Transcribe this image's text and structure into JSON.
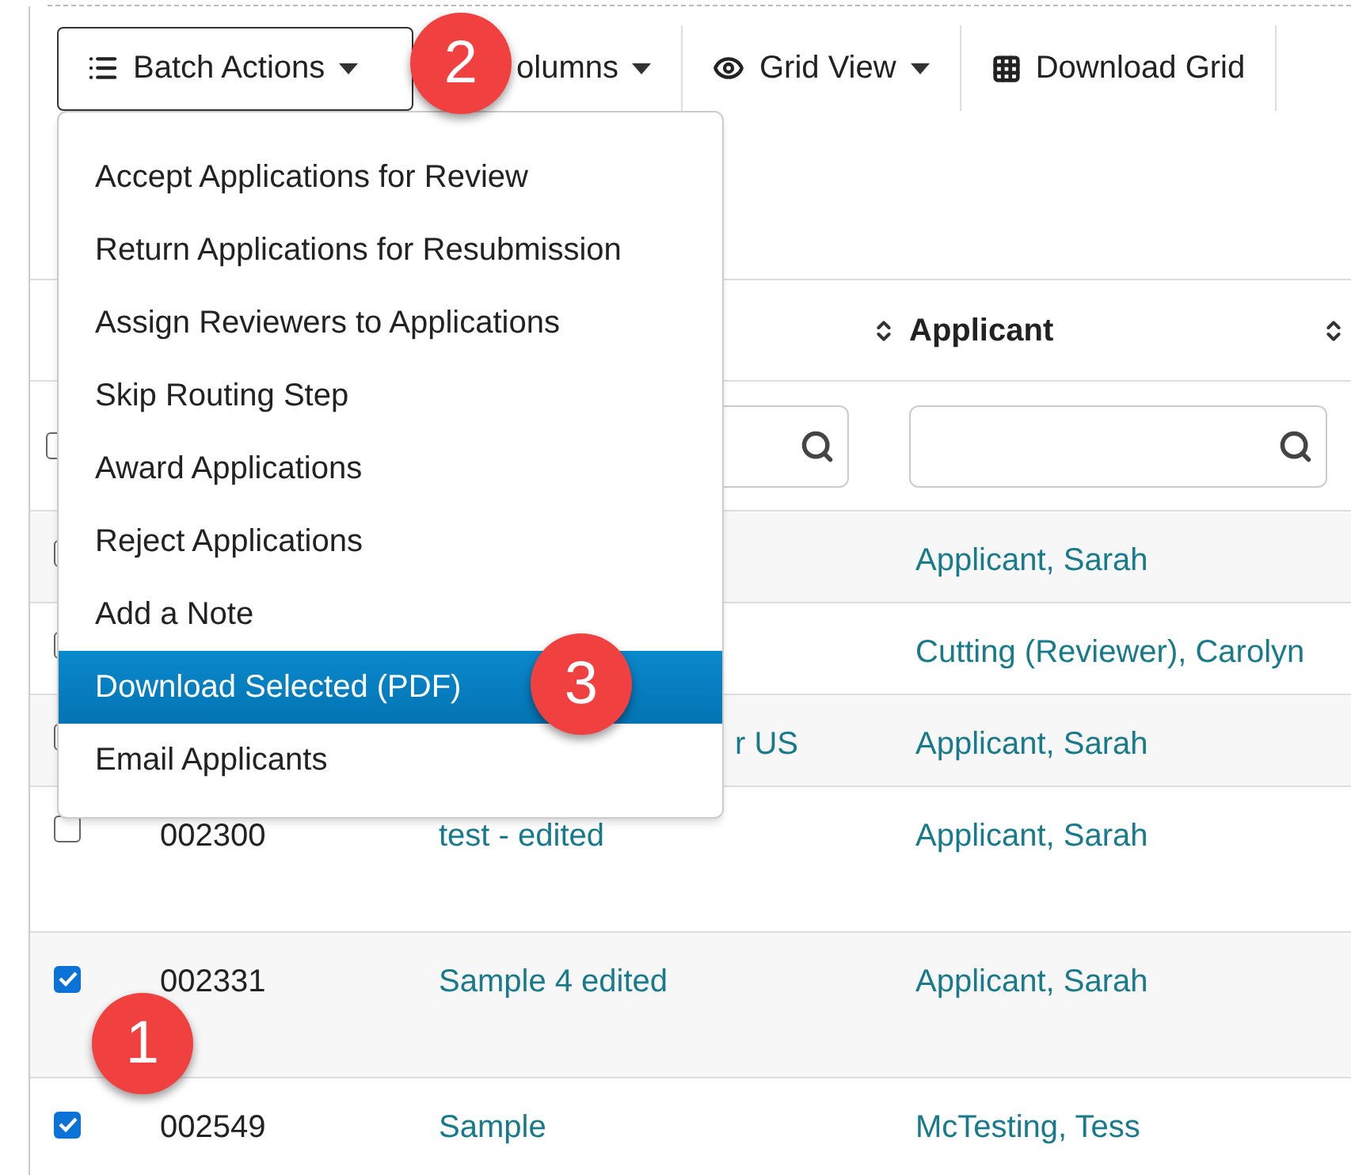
{
  "toolbar": [
    {
      "label": "Batch Actions",
      "expanded": true
    },
    {
      "label": "olumns",
      "expanded": false
    },
    {
      "label": "Grid View",
      "expanded": false
    },
    {
      "label": "Download Grid",
      "expanded": false
    }
  ],
  "menu": [
    {
      "label": "Accept Applications for Review",
      "selected": false
    },
    {
      "label": "Return Applications for Resubmission",
      "selected": false
    },
    {
      "label": "Assign Reviewers to Applications",
      "selected": false
    },
    {
      "label": "Skip Routing Step",
      "selected": false
    },
    {
      "label": "Award Applications",
      "selected": false
    },
    {
      "label": "Reject Applications",
      "selected": false
    },
    {
      "label": "Add a Note",
      "selected": false
    },
    {
      "label": "Download Selected (PDF)",
      "selected": true
    },
    {
      "label": "Email Applicants",
      "selected": false
    }
  ],
  "table": {
    "header": {
      "column_4": "Applicant"
    },
    "filter": {
      "select_all_checked": false
    },
    "rows": [
      {
        "checked": false,
        "applicant": "Applicant, Sarah"
      },
      {
        "checked": false,
        "applicant": "Cutting (Reviewer), Carolyn"
      },
      {
        "checked": false,
        "title": "r US",
        "applicant": "Applicant, Sarah"
      },
      {
        "checked": false,
        "number": "002300",
        "title": "test - edited",
        "applicant": "Applicant, Sarah"
      },
      {
        "checked": true,
        "number": "002331",
        "title": "Sample 4 edited",
        "applicant": "Applicant, Sarah"
      },
      {
        "checked": true,
        "number": "002549",
        "title": "Sample",
        "applicant": "McTesting, Tess"
      }
    ]
  },
  "callouts": [
    "1",
    "2",
    "3"
  ]
}
